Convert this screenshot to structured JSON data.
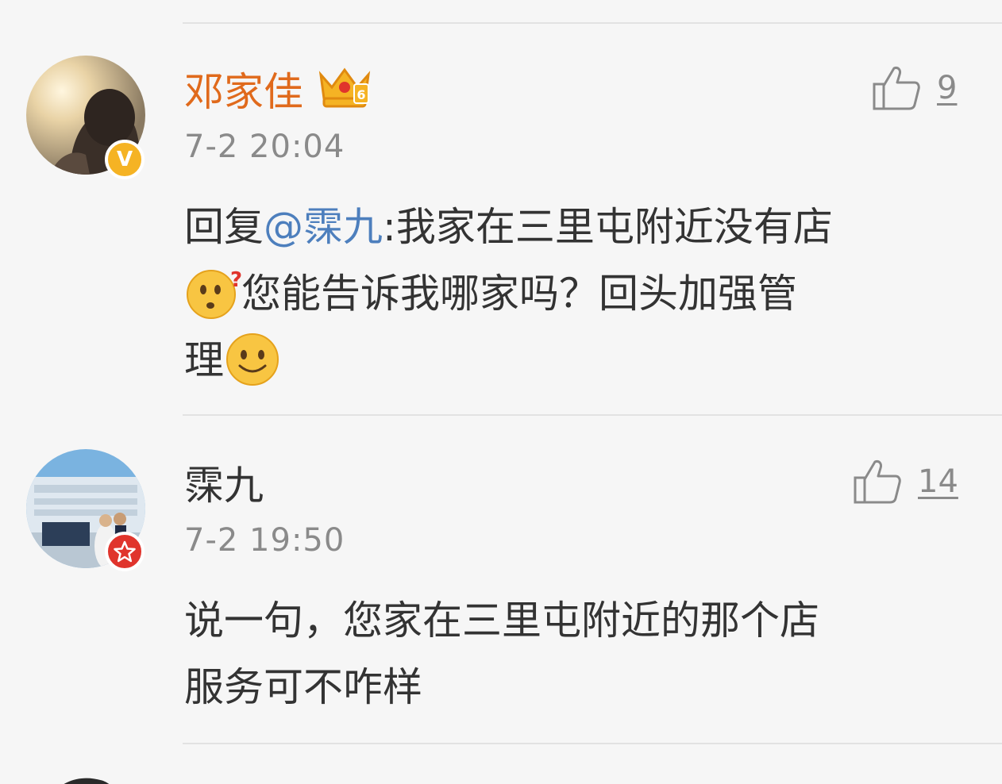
{
  "comments": [
    {
      "username": "邓家佳",
      "timestamp": "7-2 20:04",
      "like_count": "9",
      "reply_prefix": "回复",
      "mention": "@霂九",
      "text_part1": ":我家在三里屯附近没有店",
      "text_part2": "您能告诉我哪家吗？回头加强管",
      "text_part3": "理",
      "badge_label": "V"
    },
    {
      "username": "霂九",
      "timestamp": "7-2 19:50",
      "like_count": "14",
      "text_line1": "说一句，您家在三里屯附近的那个店",
      "text_line2": "服务可不咋样"
    }
  ],
  "icons": {
    "like": "thumbs-up-icon",
    "crown": "vip-crown-icon",
    "verified": "verified-v-badge-icon",
    "star": "star-badge-icon",
    "emoji_confused": "confused-emoji-icon",
    "emoji_smile": "smile-emoji-icon"
  },
  "colors": {
    "vip_name": "#e06a1c",
    "mention": "#4d7fbd",
    "timestamp": "#8a8a8a",
    "badge_gold": "#f5b324",
    "badge_red": "#e0342c",
    "background": "#f6f6f6"
  }
}
